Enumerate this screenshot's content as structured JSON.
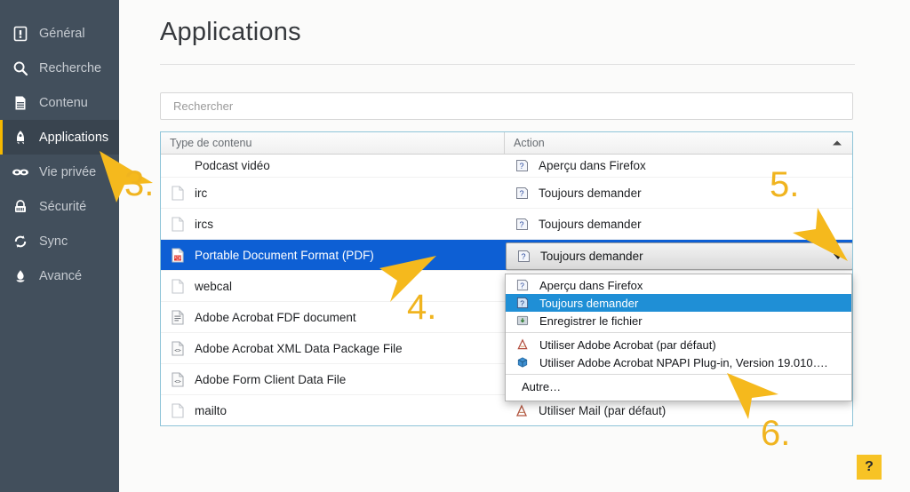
{
  "sidebar": {
    "items": [
      {
        "label": "Général",
        "icon": "general-icon",
        "active": false
      },
      {
        "label": "Recherche",
        "icon": "search-icon",
        "active": false
      },
      {
        "label": "Contenu",
        "icon": "content-icon",
        "active": false
      },
      {
        "label": "Applications",
        "icon": "rocket-icon",
        "active": true
      },
      {
        "label": "Vie privée",
        "icon": "mask-icon",
        "active": false
      },
      {
        "label": "Sécurité",
        "icon": "lock-icon",
        "active": false
      },
      {
        "label": "Sync",
        "icon": "sync-icon",
        "active": false
      },
      {
        "label": "Avancé",
        "icon": "flask-icon",
        "active": false
      }
    ]
  },
  "main": {
    "title": "Applications",
    "search": {
      "placeholder": "Rechercher",
      "value": ""
    },
    "table": {
      "columns": [
        {
          "label": "Type de contenu",
          "name": "content-type"
        },
        {
          "label": "Action",
          "name": "action",
          "sorted": "asc"
        }
      ],
      "rows": [
        {
          "type": "Podcast vidéo",
          "type_icon": "none",
          "action": "Aperçu dans Firefox",
          "action_icon": "question-doc-icon",
          "selected": false
        },
        {
          "type": "irc",
          "type_icon": "file-icon",
          "action": "Toujours demander",
          "action_icon": "question-doc-icon",
          "selected": false
        },
        {
          "type": "ircs",
          "type_icon": "file-icon",
          "action": "Toujours demander",
          "action_icon": "question-doc-icon",
          "selected": false
        },
        {
          "type": "Portable Document Format (PDF)",
          "type_icon": "pdf-icon",
          "action": "Toujours demander",
          "action_icon": "question-doc-icon",
          "selected": true
        },
        {
          "type": "webcal",
          "type_icon": "file-icon",
          "action": "",
          "action_icon": "none",
          "selected": false
        },
        {
          "type": "Adobe Acrobat FDF document",
          "type_icon": "fdf-icon",
          "action": "",
          "action_icon": "none",
          "selected": false
        },
        {
          "type": "Adobe Acrobat XML Data Package File",
          "type_icon": "xml-icon",
          "action": "",
          "action_icon": "none",
          "selected": false
        },
        {
          "type": "Adobe Form Client Data File",
          "type_icon": "xml-icon",
          "action": "",
          "action_icon": "none",
          "selected": false
        },
        {
          "type": "mailto",
          "type_icon": "file-icon",
          "action": "Utiliser Mail (par défaut)",
          "action_icon": "mail-app-icon",
          "selected": false
        }
      ]
    },
    "select": {
      "value": "Toujours demander",
      "icon": "question-doc-icon"
    },
    "dropdown": {
      "options": [
        {
          "label": "Aperçu dans Firefox",
          "icon": "question-doc-icon",
          "highlight": false,
          "sep_after": false
        },
        {
          "label": "Toujours demander",
          "icon": "question-doc-icon",
          "highlight": true,
          "sep_after": false
        },
        {
          "label": "Enregistrer le fichier",
          "icon": "save-icon",
          "highlight": false,
          "sep_after": true
        },
        {
          "label": "Utiliser Adobe Acrobat (par défaut)",
          "icon": "acrobat-icon",
          "highlight": false,
          "sep_after": false
        },
        {
          "label": "Utiliser Adobe Acrobat NPAPI Plug-in, Version 19.010….",
          "icon": "plugin-icon",
          "highlight": false,
          "sep_after": true
        },
        {
          "label": "Autre…",
          "icon": "none",
          "highlight": false,
          "sep_after": false
        }
      ]
    },
    "help_button": {
      "label": "?"
    }
  },
  "annotations": {
    "accent_color": "#f0b41f",
    "steps": [
      {
        "label": "3."
      },
      {
        "label": "4."
      },
      {
        "label": "5."
      },
      {
        "label": "6."
      }
    ]
  }
}
